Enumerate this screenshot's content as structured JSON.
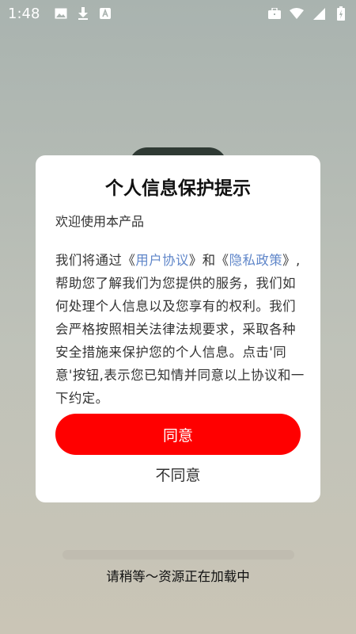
{
  "status_bar": {
    "time": "1:48",
    "left_icons": [
      "image-icon",
      "download-icon",
      "font-a-icon"
    ],
    "right_icons": [
      "briefcase-icon",
      "wifi-icon",
      "signal-icon",
      "battery-icon"
    ]
  },
  "dialog": {
    "title": "个人信息保护提示",
    "welcome": "欢迎使用本产品",
    "body": {
      "part1": "我们将通过《",
      "link_user_agreement": "用户协议",
      "part2": "》和《",
      "link_privacy_policy": "隐私政策",
      "part3": "》,帮助您了解我们为您提供的服务，我们如何处理个人信息以及您享有的权利。我们会严格按照相关法律法规要求，采取各种安全措施来保护您的个人信息。点击'同意'按钮,表示您已知情并同意以上协议和一下约定。"
    },
    "agree_label": "同意",
    "disagree_label": "不同意"
  },
  "loading": {
    "text": "请稍等～资源正在加载中",
    "progress": 0
  },
  "colors": {
    "accent": "#ff0000",
    "link": "#5f86c9"
  }
}
